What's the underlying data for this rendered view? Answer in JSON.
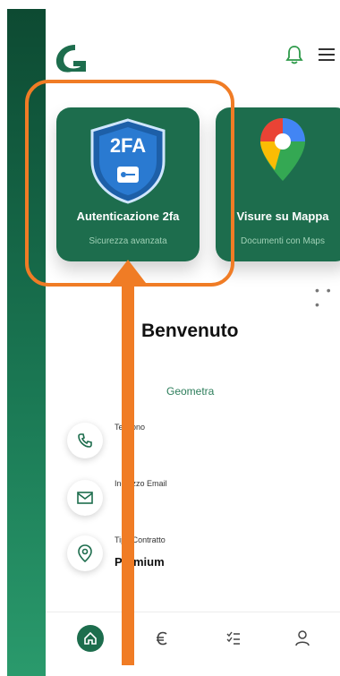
{
  "header": {
    "logo_icon": "g-logo-icon",
    "bell_icon": "bell-icon",
    "menu_icon": "menu-icon"
  },
  "cards": [
    {
      "badge_text": "2FA",
      "title": "Autenticazione 2fa",
      "subtitle": "Sicurezza avanzata",
      "icon": "shield-key-icon"
    },
    {
      "title": "Visure su Mappa",
      "subtitle": "Documenti con Maps",
      "icon": "map-pin-icon"
    }
  ],
  "welcome": {
    "title": "Benvenuto",
    "role": "Geometra"
  },
  "info": {
    "phone_label": "Telefono",
    "email_label": "Indirizzo Email",
    "contract_label": "Tipo Contratto",
    "contract_value": "Premium"
  },
  "bottom_nav": {
    "items": [
      "home-icon",
      "euro-icon",
      "checklist-icon",
      "user-icon"
    ]
  },
  "colors": {
    "brand": "#1d6d4d",
    "accent_highlight": "#f07c25",
    "strip": "#0d4a32"
  }
}
